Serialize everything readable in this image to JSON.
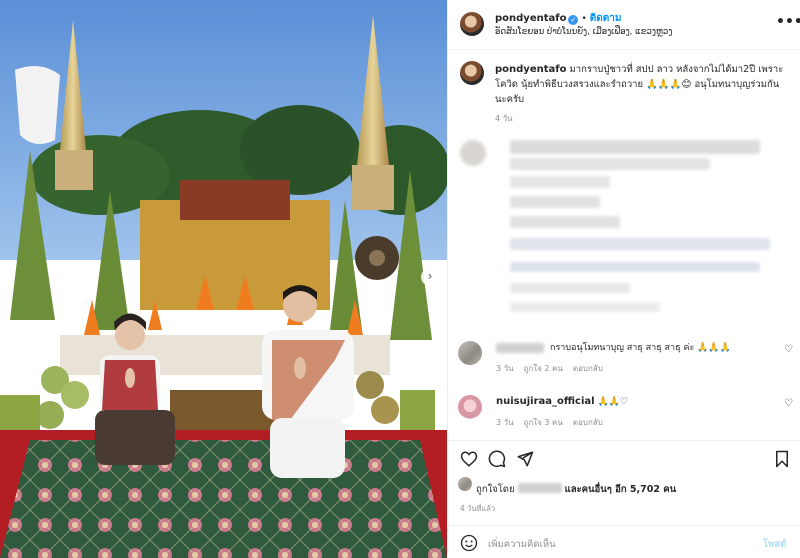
{
  "post": {
    "username": "pondyentafo",
    "follow_label": "ติดตาม",
    "location": "ອັດສັນໂຂຍອນ ປ່າບໍ່ໂນນຍ໌ງ, ເມືອງເຟືອງ, ແຂວງຫຼວງ",
    "more_label": "•••",
    "caption_username": "pondyentafo",
    "caption": "มากราบปู่ชาวที่ สปป ลาว หลังจากไม่ได้มา2ปี เพราะโควิด นุ้ยทำพิธีบวงสรวงและรำถวาย 🙏🙏🙏😊 อนุโมทนาบุญร่วมกันนะครับ",
    "caption_time": "4 วัน"
  },
  "comments": [
    {
      "text": "กราบอนุโมทนาบุญ สาธุ สาธุ สาธุ ค่ะ 🙏🙏🙏",
      "time": "3 วัน",
      "likes": "ถูกใจ 2 คน",
      "reply": "ตอบกลับ"
    },
    {
      "username": "nuisujiraa_official",
      "text": "🙏🙏♡",
      "time": "3 วัน",
      "likes": "ถูกใจ 3 คน",
      "reply": "ตอบกลับ"
    }
  ],
  "actions": {
    "liked_by_prefix": "ถูกใจโดย",
    "liked_by_suffix": "และคนอื่นๆ อีก 5,702 คน",
    "post_date": "4 วันที่แล้ว",
    "add_comment_placeholder": "เพิ่มความคิดเห็น",
    "post_button": "โพสต์",
    "next_arrow": "›"
  },
  "icons": [
    "heart-icon",
    "comment-icon",
    "share-icon",
    "bookmark-icon",
    "emoji-icon",
    "more-icon",
    "verified-icon",
    "next-arrow-icon"
  ],
  "colors": {
    "link_blue": "#0095f6",
    "verified_blue": "#3897f0",
    "muted": "#8e8e8e",
    "post_disabled": "#b2dffc"
  }
}
